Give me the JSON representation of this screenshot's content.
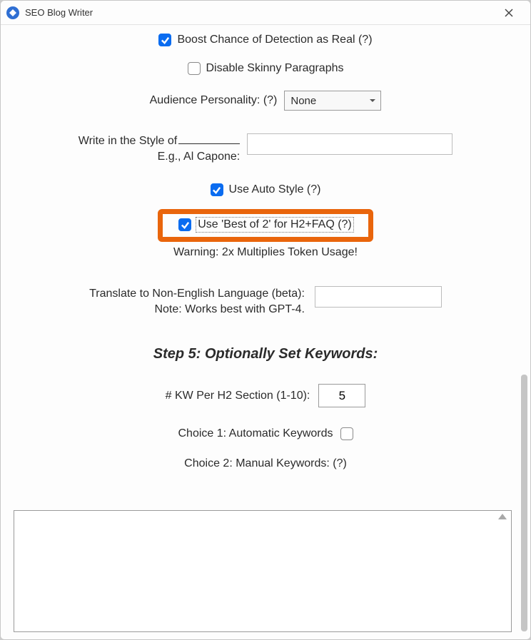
{
  "window": {
    "title": "SEO Blog Writer"
  },
  "options": {
    "boost_detection": {
      "label": "Boost Chance of Detection as Real (?)",
      "checked": true
    },
    "disable_skinny": {
      "label": "Disable Skinny Paragraphs",
      "checked": false
    },
    "audience_personality": {
      "label": "Audience Personality: (?)",
      "value": "None"
    },
    "write_style": {
      "line1": "Write in the Style of",
      "line2": "E.g., Al Capone:",
      "value": ""
    },
    "use_auto_style": {
      "label": "Use Auto Style (?)",
      "checked": true
    },
    "best_of_2": {
      "label": "Use 'Best of 2' for H2+FAQ (?)",
      "checked": true
    },
    "warning_best_of_2": "Warning: 2x Multiplies Token Usage!",
    "translate": {
      "line1": "Translate to Non-English Language (beta):",
      "line2": "Note: Works best with GPT-4.",
      "value": ""
    }
  },
  "step5": {
    "heading": "Step 5: Optionally Set Keywords:",
    "kw_per_h2": {
      "label": "# KW Per H2 Section (1-10):",
      "value": "5"
    },
    "choice1": {
      "label": "Choice 1: Automatic Keywords",
      "checked": false
    },
    "choice2_label": "Choice 2: Manual Keywords: (?)",
    "manual_keywords_value": ""
  }
}
